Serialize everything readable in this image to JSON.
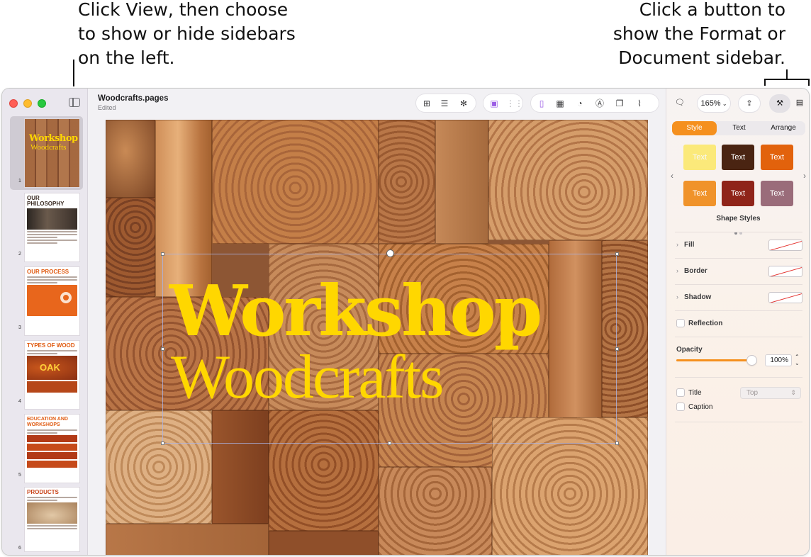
{
  "callouts": {
    "left": [
      "Click View, then choose",
      "to show or hide sidebars",
      "on the left."
    ],
    "right": [
      "Click a button to",
      "show the Format or",
      "Document sidebar."
    ]
  },
  "window": {
    "document_name": "Woodcrafts.pages",
    "document_status": "Edited"
  },
  "toolbar": {
    "icons": [
      "add-page-icon",
      "insert-list-icon",
      "collaborate-icon",
      "image-playground-icon",
      "image-grid-icon",
      "text-box-icon",
      "table-icon",
      "chart-icon",
      "text-icon",
      "shape-icon",
      "media-icon",
      "comment-icon",
      "share-icon",
      "format-brush-icon",
      "document-icon"
    ],
    "zoom": "165%"
  },
  "thumbnails": [
    {
      "number": "1",
      "title_a": "Workshop",
      "title_b": "Woodcrafts"
    },
    {
      "number": "2",
      "title": "OUR PHILOSOPHY"
    },
    {
      "number": "3",
      "title": "OUR PROCESS"
    },
    {
      "number": "4",
      "title": "TYPES OF WOOD",
      "label": "OAK"
    },
    {
      "number": "5",
      "title": "EDUCATION AND WORKSHOPS"
    },
    {
      "number": "6",
      "title": "PRODUCTS"
    }
  ],
  "canvas": {
    "headline": "Workshop",
    "subhead": "Woodcrafts"
  },
  "format_sidebar": {
    "tabs": [
      "Style",
      "Text",
      "Arrange"
    ],
    "active_tab": "Style",
    "swatches": [
      {
        "label": "Text",
        "bg": "#fbe97a",
        "fg": "#f7f7f7"
      },
      {
        "label": "Text",
        "bg": "#4a2412",
        "fg": "#ffffff"
      },
      {
        "label": "Text",
        "bg": "#e2620c",
        "fg": "#ffffff"
      },
      {
        "label": "Text",
        "bg": "#f0932a",
        "fg": "#ffffff"
      },
      {
        "label": "Text",
        "bg": "#8f2419",
        "fg": "#ffffff"
      },
      {
        "label": "Text",
        "bg": "#9a6c7a",
        "fg": "#ffffff"
      }
    ],
    "shape_styles_label": "Shape Styles",
    "fill_label": "Fill",
    "border_label": "Border",
    "shadow_label": "Shadow",
    "reflection_label": "Reflection",
    "opacity_label": "Opacity",
    "opacity_value": "100%",
    "opacity_fraction": 1.0,
    "title_label": "Title",
    "title_position": "Top",
    "caption_label": "Caption"
  },
  "colors": {
    "accent": "#f5901e",
    "headline": "#ffd700"
  }
}
